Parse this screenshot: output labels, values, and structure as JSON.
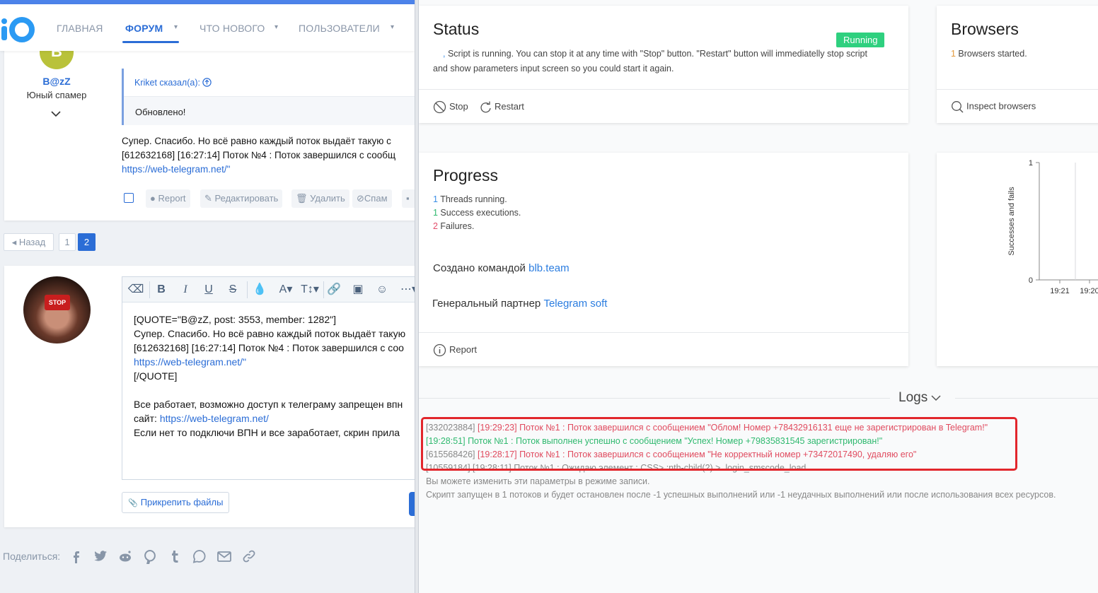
{
  "forum": {
    "nav": {
      "items": [
        {
          "label": "ГЛАВНАЯ"
        },
        {
          "label": "ФОРУМ"
        },
        {
          "label": "ЧТО НОВОГО"
        },
        {
          "label": "ПОЛЬЗОВАТЕЛИ"
        }
      ],
      "accent": "#2b6dd6"
    },
    "post1": {
      "avatar_letter": "B",
      "user_name": "B@zZ",
      "user_title": "Юный спамер",
      "quote_author": "Kriket сказал(а):",
      "quote_text": "Обновлено!",
      "lines": [
        "Супер. Спасибо. Но всё равно каждый поток выдаёт такую с",
        "[612632168] [16:27:14] Поток №4 : Поток завершился с сообщ"
      ],
      "link": "https://web-telegram.net/\"",
      "actions": {
        "report": "Report",
        "edit": "Редактировать",
        "delete": "Удалить",
        "spam": "Спам"
      }
    },
    "pager": {
      "prev": "◂ Назад",
      "pages": [
        "1",
        "2"
      ],
      "current": "2"
    },
    "editor": {
      "stop_text": "STOP",
      "lines": [
        "[QUOTE=\"B@zZ, post: 3553, member: 1282\"]",
        "Супер. Спасибо. Но всё равно каждый поток выдаёт такую",
        "[612632168] [16:27:14] Поток №4 : Поток завершился с соо"
      ],
      "link1": "https://web-telegram.net/\"",
      "close_quote": "[/QUOTE]",
      "line_works": "Все работает, возможно доступ к телеграму запрещен впн",
      "site_prefix": "сайт: ",
      "link2": "https://web-telegram.net/",
      "line_vpn": "Если нет то подключи ВПН и все заработает, скрин прила",
      "attach_label": "Прикрепить файлы"
    },
    "share_label": "Поделиться:",
    "share_icons": [
      "facebook-icon",
      "twitter-icon",
      "reddit-icon",
      "pinterest-icon",
      "tumblr-icon",
      "whatsapp-icon",
      "email-icon",
      "link-icon"
    ]
  },
  "dashboard": {
    "status": {
      "title": "Status",
      "badge": "Running",
      "badge_color": "#2fd07f",
      "prefix": ",",
      "text_line1": " Script is running. You can stop it at any time with \"Stop\" button. \"Restart\" button will immediatelly stop script",
      "text_line2": "and show parameters input screen so you could start it again.",
      "stop_label": "Stop",
      "restart_label": "Restart"
    },
    "browsers": {
      "title": "Browsers",
      "count": "1",
      "text": " Browsers started.",
      "inspect_label": "Inspect browsers"
    },
    "progress": {
      "title": "Progress",
      "threads_count": "1",
      "threads_text": " Threads running.",
      "success_count": "1",
      "success_text": " Success executions.",
      "fail_count": "2",
      "fail_text": " Failures.",
      "credit1_text": "Создано командой ",
      "credit1_link": "blb.team",
      "credit2_text": "Генеральный партнер ",
      "credit2_link": "Telegram soft",
      "report_label": "Report"
    },
    "logs": {
      "title": "Logs",
      "entries": [
        {
          "prefix": "[332023884] ",
          "text": "[19:29:23] Поток №1 : Поток завершился с сообщением \"Облом! Номер +78432916131 еще не зарегистрирован в Telegram!\"",
          "color": "red"
        },
        {
          "prefix": "",
          "text": "[19:28:51] Поток №1 : Поток выполнен успешно с сообщением \"Успех! Номер +79835831545 зарегистрирован!\"",
          "color": "green"
        },
        {
          "prefix": "[615568426] ",
          "text": "[19:28:17] Поток №1 : Поток завершился с сообщением \"Не корректный номер +73472017490, удаляю его\"",
          "color": "red"
        },
        {
          "prefix": "[10559184] ",
          "text": "[19:28:11] Поток №1 : Ожидаю элемент : CSS> :nth-child(2) > .login_smscode_load",
          "color": "gray"
        },
        {
          "prefix": "",
          "text": "Вы можете изменить эти параметры в режиме записи.",
          "color": "gray"
        },
        {
          "prefix": "",
          "text": "Скрипт запущен в 1 потоков и будет остановлен после -1 успешных выполнений или -1 неудачных выполнений или после использования всех ресурсов.",
          "color": "gray"
        }
      ]
    },
    "chart_data": {
      "type": "bar",
      "categories": [
        "19:21",
        "19:20"
      ],
      "values": [
        0,
        0
      ],
      "ylabel": "Successes and fails",
      "ylim": [
        0,
        1
      ],
      "yticks": [
        "0",
        "1"
      ]
    }
  }
}
